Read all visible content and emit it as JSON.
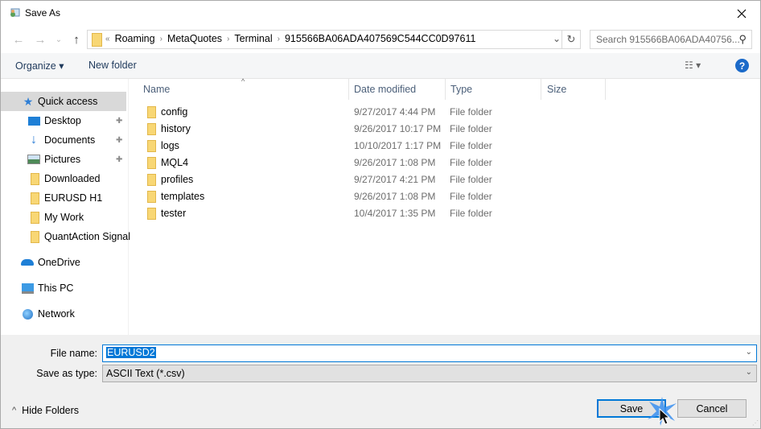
{
  "window": {
    "title": "Save As",
    "close_label": "✕"
  },
  "nav": {
    "back_icon": "←",
    "forward_icon": "→",
    "recent_icon": "⌄",
    "up_icon": "↑",
    "overflow": "«",
    "breadcrumbs": [
      "Roaming",
      "MetaQuotes",
      "Terminal",
      "915566BA06ADA407569C544CC0D97611"
    ],
    "separator": "›",
    "dropdown_icon": "⌄",
    "refresh_icon": "↻",
    "search_placeholder": "Search 915566BA06ADA40756...",
    "search_icon": "⚲"
  },
  "toolbar": {
    "organize_label": "Organize ▾",
    "new_folder_label": "New folder",
    "view_icon": "☷ ▾",
    "help_label": "?"
  },
  "sidebar": {
    "items": [
      {
        "label": "Quick access",
        "icon": "star-icon",
        "selected": true
      },
      {
        "label": "Desktop",
        "icon": "desktop-icon",
        "pinned": true
      },
      {
        "label": "Documents",
        "icon": "download-arrow-icon",
        "pinned": true
      },
      {
        "label": "Pictures",
        "icon": "pictures-icon",
        "pinned": true
      },
      {
        "label": "Downloaded",
        "icon": "folder-icon"
      },
      {
        "label": "EURUSD H1",
        "icon": "folder-icon"
      },
      {
        "label": "My Work",
        "icon": "folder-icon"
      },
      {
        "label": "QuantAction Signal",
        "icon": "folder-icon"
      },
      {
        "label": "OneDrive",
        "icon": "cloud-icon"
      },
      {
        "label": "This PC",
        "icon": "computer-icon"
      },
      {
        "label": "Network",
        "icon": "network-icon"
      }
    ],
    "pin_icon": "📌"
  },
  "columns": {
    "name": "Name",
    "date": "Date modified",
    "type": "Type",
    "size": "Size",
    "sort_icon": "^"
  },
  "files": [
    {
      "name": "config",
      "date": "9/27/2017 4:44 PM",
      "type": "File folder"
    },
    {
      "name": "history",
      "date": "9/26/2017 10:17 PM",
      "type": "File folder"
    },
    {
      "name": "logs",
      "date": "10/10/2017 1:17 PM",
      "type": "File folder"
    },
    {
      "name": "MQL4",
      "date": "9/26/2017 1:08 PM",
      "type": "File folder"
    },
    {
      "name": "profiles",
      "date": "9/27/2017 4:21 PM",
      "type": "File folder"
    },
    {
      "name": "templates",
      "date": "9/26/2017 1:08 PM",
      "type": "File folder"
    },
    {
      "name": "tester",
      "date": "10/4/2017 1:35 PM",
      "type": "File folder"
    }
  ],
  "form": {
    "file_name_label": "File name:",
    "file_name_value": "EURUSD2",
    "save_type_label": "Save as type:",
    "save_type_value": "ASCII Text (*.csv)",
    "chevron": "⌄"
  },
  "footer": {
    "hide_folders_icon": "^",
    "hide_folders_label": "Hide Folders",
    "save_label": "Save",
    "cancel_label": "Cancel"
  }
}
